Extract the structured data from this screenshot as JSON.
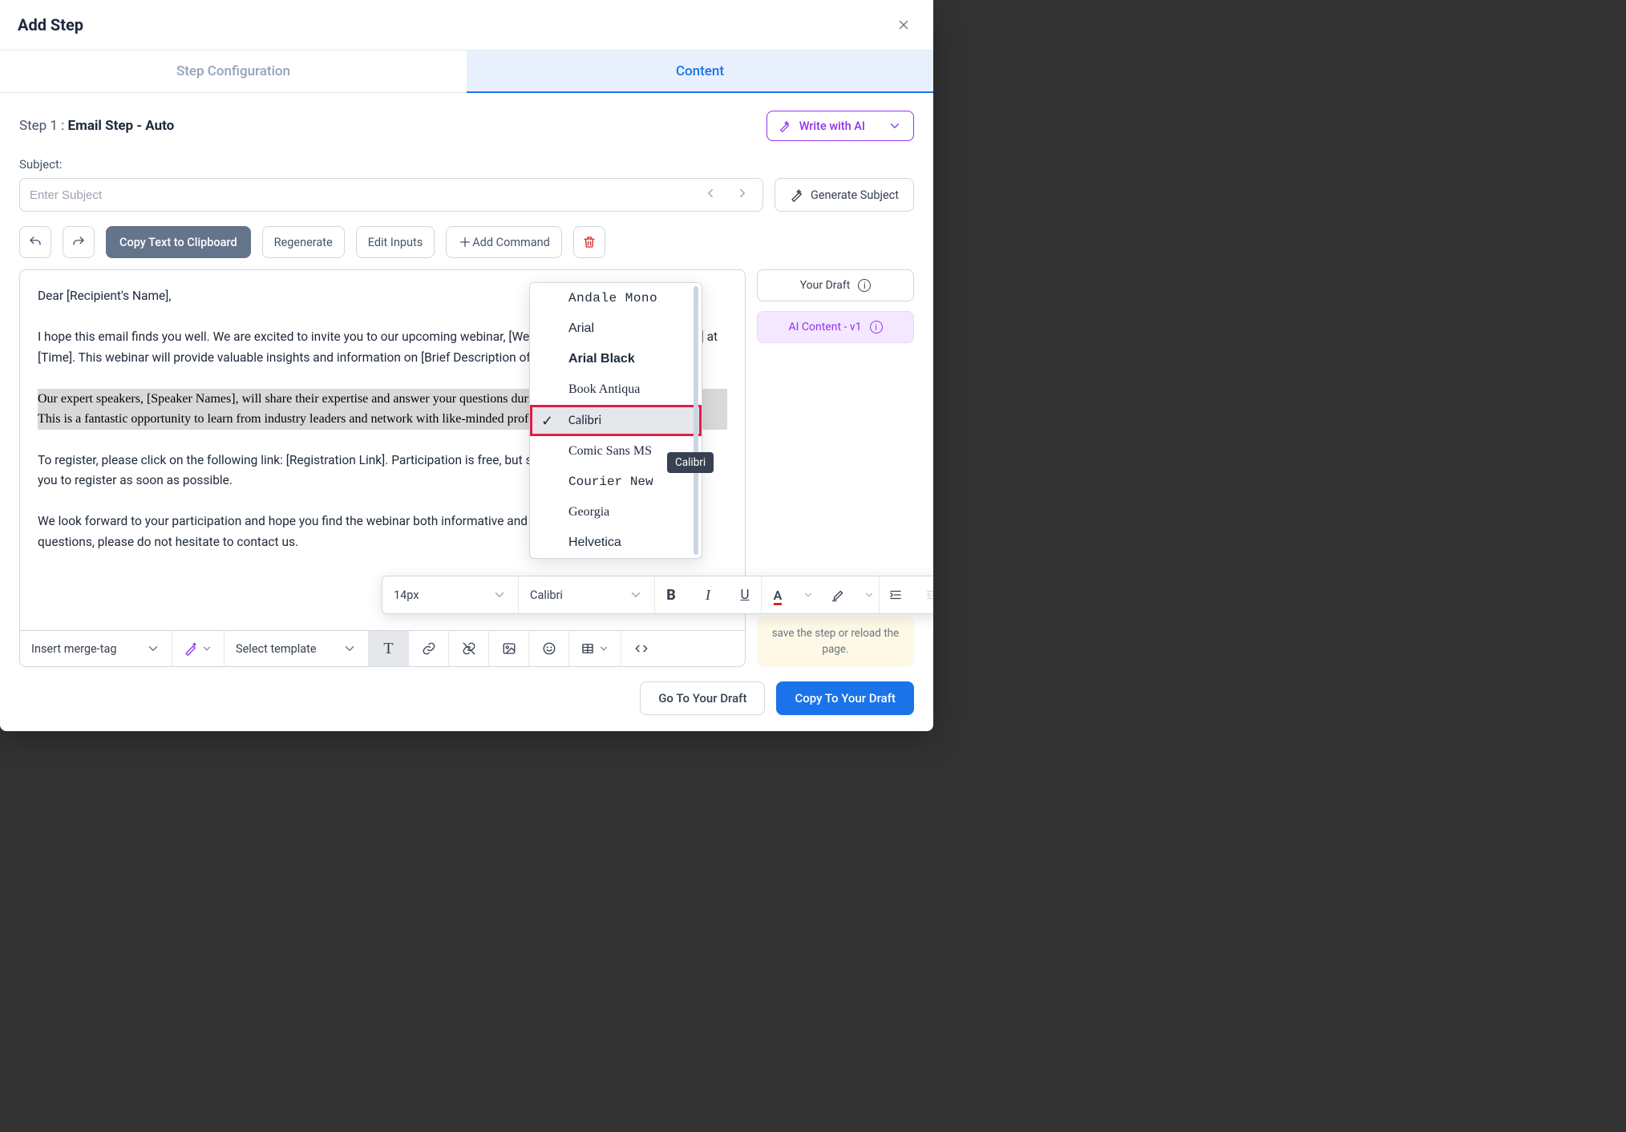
{
  "modal": {
    "title": "Add Step",
    "close_label": "Close"
  },
  "tabs": {
    "step_config": "Step Configuration",
    "content": "Content"
  },
  "step": {
    "prefix": "Step 1 : ",
    "name": "Email Step - Auto"
  },
  "write_ai": {
    "label": "Write with AI"
  },
  "subject": {
    "label": "Subject:",
    "placeholder": "Enter Subject",
    "value": ""
  },
  "generate_subject": "Generate Subject",
  "actions": {
    "undo": "Undo",
    "redo": "Redo",
    "copy_clipboard": "Copy Text to Clipboard",
    "regenerate": "Regenerate",
    "edit_inputs": "Edit Inputs",
    "add_command": "Add Command",
    "delete": "Delete"
  },
  "editor": {
    "p1": "Dear [Recipient's Name],",
    "p2": "I hope this email finds you well. We are excited to invite you to our upcoming webinar, [Webinar Title], scheduled for [Date] at [Time]. This webinar will provide valuable insights and information on [Brief Description of Webinar Content].",
    "p3a": "Our expert speakers, [Speaker Names], will share their expertise and answer your questions during the session.",
    "p3b": "This is a fantastic opportunity to learn from industry leaders and network with like-minded professionals.",
    "p4": "To register, please click on the following link: [Registration Link]. Participation is free, but space is limited, so we encourage you to register as soon as possible.",
    "p5": "We look forward to your participation and hope you find the webinar both informative and engaging. If you have any questions, please do not hesitate to contact us."
  },
  "side": {
    "your_draft": "Your Draft",
    "ai_content": "AI Content - v1",
    "warn": "save the step or reload the page."
  },
  "toolbar": {
    "insert_merge": "Insert merge-tag",
    "select_template": "Select template"
  },
  "float": {
    "size": "14px",
    "font": "Calibri"
  },
  "fonts": {
    "andale": "Andale Mono",
    "arial": "Arial",
    "arial_black": "Arial Black",
    "book": "Book Antiqua",
    "calibri": "Calibri",
    "comic": "Comic Sans MS",
    "courier": "Courier New",
    "georgia": "Georgia",
    "helvetica": "Helvetica"
  },
  "tooltip": {
    "calibri": "Calibri"
  },
  "footer": {
    "go_draft": "Go To Your Draft",
    "copy_draft": "Copy To Your Draft"
  }
}
